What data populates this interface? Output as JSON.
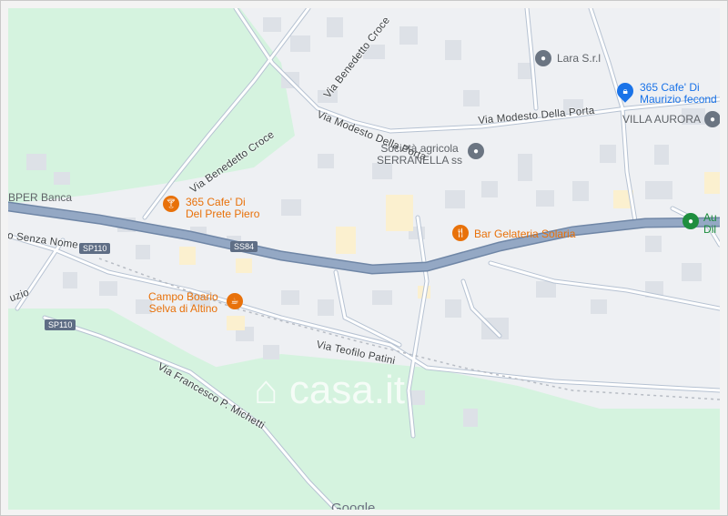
{
  "map": {
    "pois": {
      "lara": "Lara S.r.l",
      "cafe_maurizio_1": "365 Cafe' Di",
      "cafe_maurizio_2": "Maurizio fecond",
      "villa_aurora": "VILLA AURORA",
      "societa_1": "Società agricola",
      "societa_2": "SERRANELLA ss",
      "bper": "BPER Banca",
      "cafe_prete_1": "365 Cafe' Di",
      "cafe_prete_2": "Del Prete Piero",
      "bar_gelateria": "Bar Gelateria Solaria",
      "au_1": "Au",
      "au_2": "Dil",
      "campo_1": "Campo Boario",
      "campo_2": "Selva di Altino"
    },
    "streets": {
      "benedetto_croce_1": "Via Benedetto Croce",
      "benedetto_croce_2": "Via Benedetto Croce",
      "modesto_1": "Via Modesto Della Porta",
      "modesto_2": "Via Modesto Della Porta",
      "senza_nome": "o Senza Nome",
      "uzio": "uzio",
      "teofilo": "Via Teofilo Patini",
      "francesco": "Via Francesco P. Michetti"
    },
    "shields": {
      "sp110_a": "SP110",
      "ss84": "SS84",
      "sp110_b": "SP110"
    },
    "watermark": "casa.it",
    "google_logo": "Google",
    "icons": {
      "cafe": "cocktail-icon",
      "bar": "restaurant-icon",
      "coffee": "coffee-icon",
      "shop": "lock-icon",
      "place": "place-pin-icon",
      "attraction": "attraction-pin-icon"
    },
    "colors": {
      "main_road": "#8fa3bf",
      "green_area": "#d4f2de",
      "poi_orange": "#e8710a",
      "poi_blue": "#1a73e8",
      "poi_green": "#1e8e3e"
    }
  }
}
